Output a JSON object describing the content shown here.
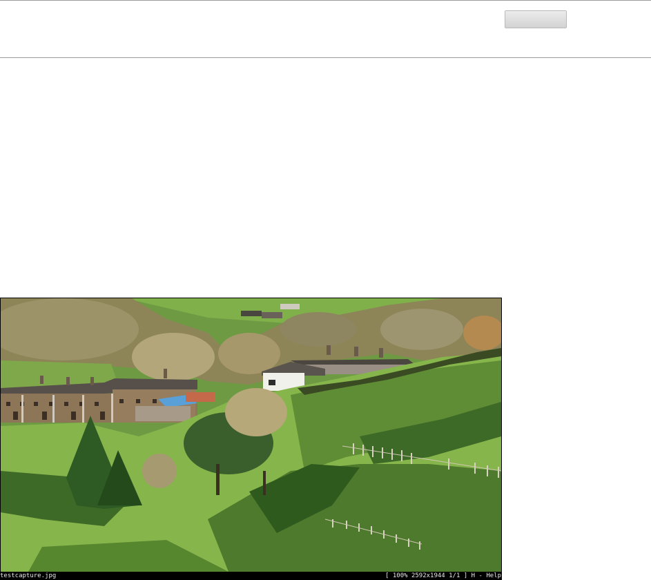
{
  "toolbar": {
    "button_label": ""
  },
  "viewer": {
    "filename": "testcapture.jpg",
    "status": "[ 100% 2592x1944 1/1 ] H - Help"
  },
  "colors": {
    "sky_hill": "#7aa84a",
    "grass_light": "#8fbf4f",
    "grass_shadow": "#2f5a1e",
    "stone_houses": "#8a7458",
    "roofs": "#5a5048",
    "bare_trees": "#a89a6a",
    "white_house": "#f2f2ee",
    "status_bg": "#000000",
    "status_text": "#e8e8e8"
  }
}
